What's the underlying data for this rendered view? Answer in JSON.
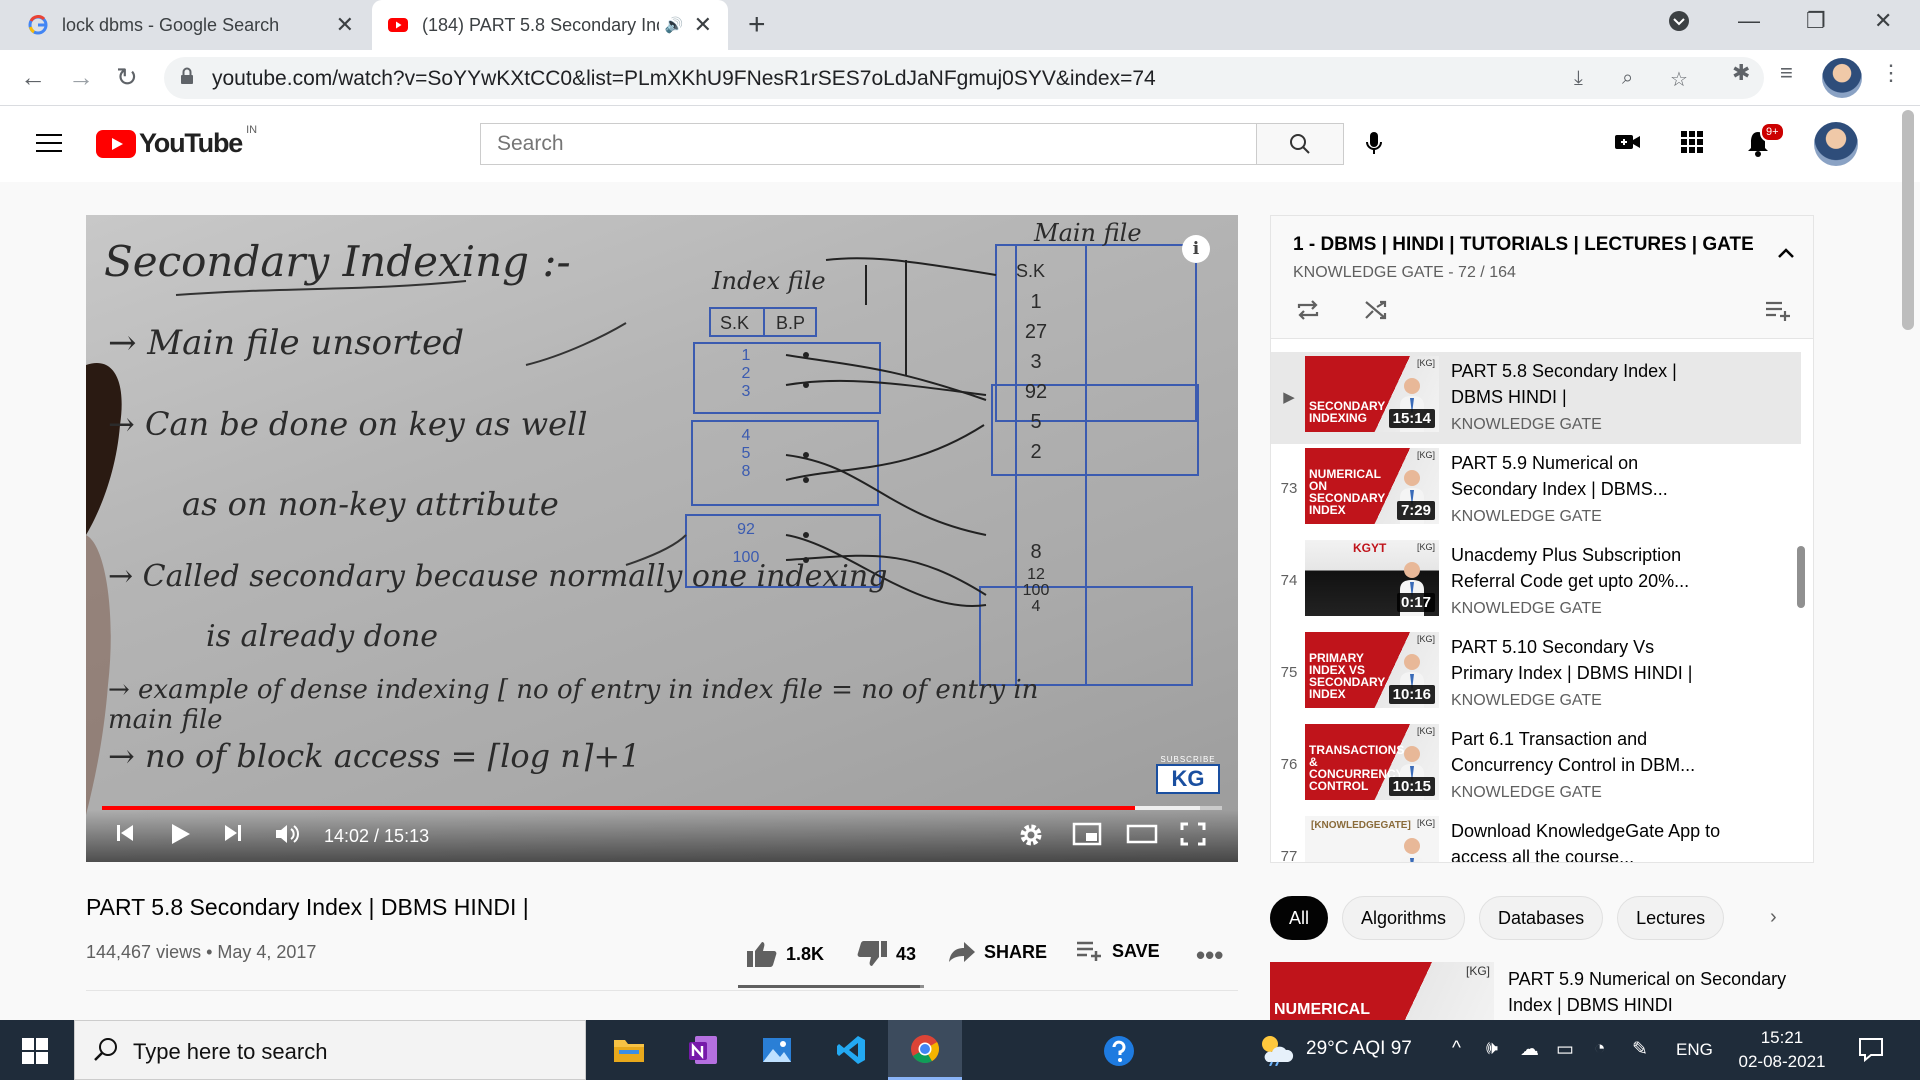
{
  "browser": {
    "tabs": [
      {
        "title": "lock dbms - Google Search",
        "favicon": "google-g-icon"
      },
      {
        "title": "(184) PART 5.8 Secondary Ind",
        "favicon": "youtube-icon",
        "audio": "🔊"
      }
    ],
    "url": "youtube.com/watch?v=SoYYwKXtCC0&list=PLmXKhU9FNesR1rSES7oLdJaNFgmuj0SYV&index=74"
  },
  "youtube": {
    "logo_text": "YouTube",
    "country": "IN",
    "search_placeholder": "Search",
    "notifications": "9+"
  },
  "player": {
    "time": "14:02 / 15:13",
    "progress": 0.922,
    "buffered": 0.98,
    "watermark_sub": "SUBSCRIBE",
    "watermark_kg": "KG",
    "board": {
      "heading": "Secondary Indexing :-",
      "lines": [
        "→ Main file unsorted",
        "→ Can be done on key as well",
        "as on non-key attribute",
        "→ Called secondary because normally one indexing",
        "is already done",
        "→ example of dense indexing [ no of entry in index file = no of entry in main file",
        "→ no of block access = ⌈log n⌉+1"
      ],
      "index_file_label": "Index file",
      "main_file_label": "Main file",
      "index_cols": [
        "S.K",
        "B.P"
      ],
      "index_values": [
        "1",
        "2",
        "3",
        "4",
        "5",
        "8",
        "92",
        "100"
      ],
      "main_col": "S.K",
      "main_values": [
        "1",
        "27",
        "3",
        "92",
        "5",
        "2",
        "8",
        "12",
        "100",
        "4"
      ]
    }
  },
  "video": {
    "title": "PART 5.8 Secondary Index | DBMS HINDI |",
    "meta": "144,467 views • May 4, 2017",
    "likes": "1.8K",
    "dislikes": "43",
    "like_ratio": 0.977,
    "share": "SHARE",
    "save": "SAVE"
  },
  "playlist": {
    "title": "1 - DBMS | HINDI | TUTORIALS | LECTURES | GATE | N",
    "subtitle": "KNOWLEDGE GATE - 72 / 164",
    "items": [
      {
        "index": "▶",
        "title": "PART 5.8 Secondary Index | DBMS HINDI |",
        "channel": "KNOWLEDGE GATE",
        "duration": "15:14",
        "thumb_label": "SECONDARY INDEXING",
        "current": true
      },
      {
        "index": "73",
        "title": "PART 5.9 Numerical on Secondary Index | DBMS...",
        "channel": "KNOWLEDGE GATE",
        "duration": "7:29",
        "thumb_label": "NUMERICAL ON SECONDARY INDEX"
      },
      {
        "index": "74",
        "title": "Unacdemy Plus Subscription Referral Code get upto 20%...",
        "channel": "KNOWLEDGE GATE",
        "duration": "0:17",
        "thumb_label": "KGYT"
      },
      {
        "index": "75",
        "title": "PART 5.10 Secondary Vs Primary Index | DBMS HINDI |",
        "channel": "KNOWLEDGE GATE",
        "duration": "10:16",
        "thumb_label": "PRIMARY INDEX VS SECONDARY INDEX"
      },
      {
        "index": "76",
        "title": "Part 6.1 Transaction and Concurrency Control in DBM...",
        "channel": "KNOWLEDGE GATE",
        "duration": "10:15",
        "thumb_label": "TRANSACTIONS & CONCURRENCY CONTROL"
      },
      {
        "index": "77",
        "title": "Download KnowledgeGate App to access all the course...",
        "channel": "",
        "duration": "",
        "thumb_label": "[KNOWLEDGEGATE]"
      }
    ]
  },
  "chips": [
    "All",
    "Algorithms",
    "Databases",
    "Lectures"
  ],
  "recommendation": {
    "title": "PART 5.9 Numerical on Secondary Index | DBMS HINDI",
    "thumb_label": "NUMERICAL",
    "brand": "[KG]"
  },
  "taskbar": {
    "search_placeholder": "Type here to search",
    "weather": "29°C  AQI 97",
    "lang": "ENG",
    "time": "15:21",
    "date": "02-08-2021"
  }
}
